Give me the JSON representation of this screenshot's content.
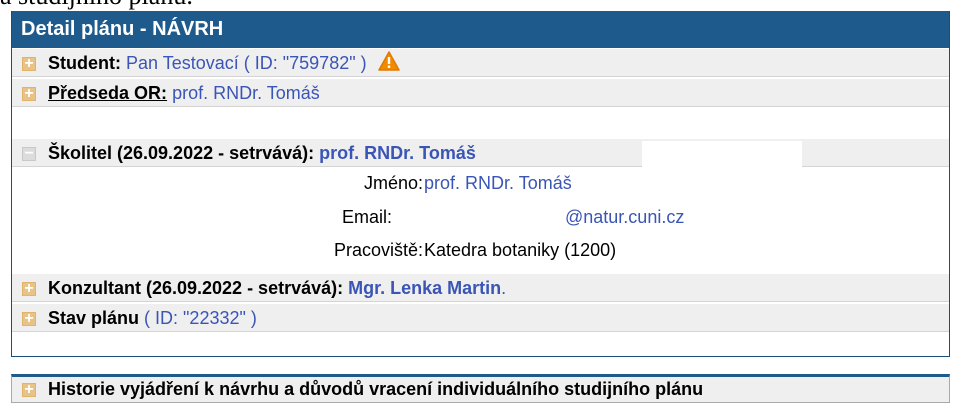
{
  "cut_text": "a studijního plánu.",
  "panel": {
    "title": "Detail plánu - NÁVRH",
    "student": {
      "label": "Student:",
      "name": "Pan Testovací",
      "id_text": "( ID: \"759782\" )",
      "icon": "warning-icon"
    },
    "predseda": {
      "label": "Předseda OR:",
      "name": "prof. RNDr. Tomáš"
    },
    "skolitel": {
      "label": "Školitel (26.09.2022 - setrvává):",
      "name": "prof. RNDr. Tomáš",
      "details": {
        "jmeno_label": "Jméno:",
        "jmeno_value": "prof. RNDr. Tomáš",
        "email_label": "Email:",
        "email_value": "@natur.cuni.cz",
        "pracoviste_label": "Pracoviště:",
        "pracoviste_value": "Katedra botaniky (1200)"
      }
    },
    "konzultant": {
      "label": "Konzultant (26.09.2022 - setrvává):",
      "name": "Mgr. Lenka Martin",
      "trail": "."
    },
    "stav": {
      "label": "Stav plánu",
      "id_text": "( ID: \"22332\" )"
    }
  },
  "history": {
    "label": "Historie vyjádření k návrhu a důvodů vracení individuálního studijního plánu"
  },
  "colors": {
    "header": "#1e5a8c",
    "link": "#3a55b5",
    "warning": "#f08a00",
    "row_bg": "#efefef"
  }
}
